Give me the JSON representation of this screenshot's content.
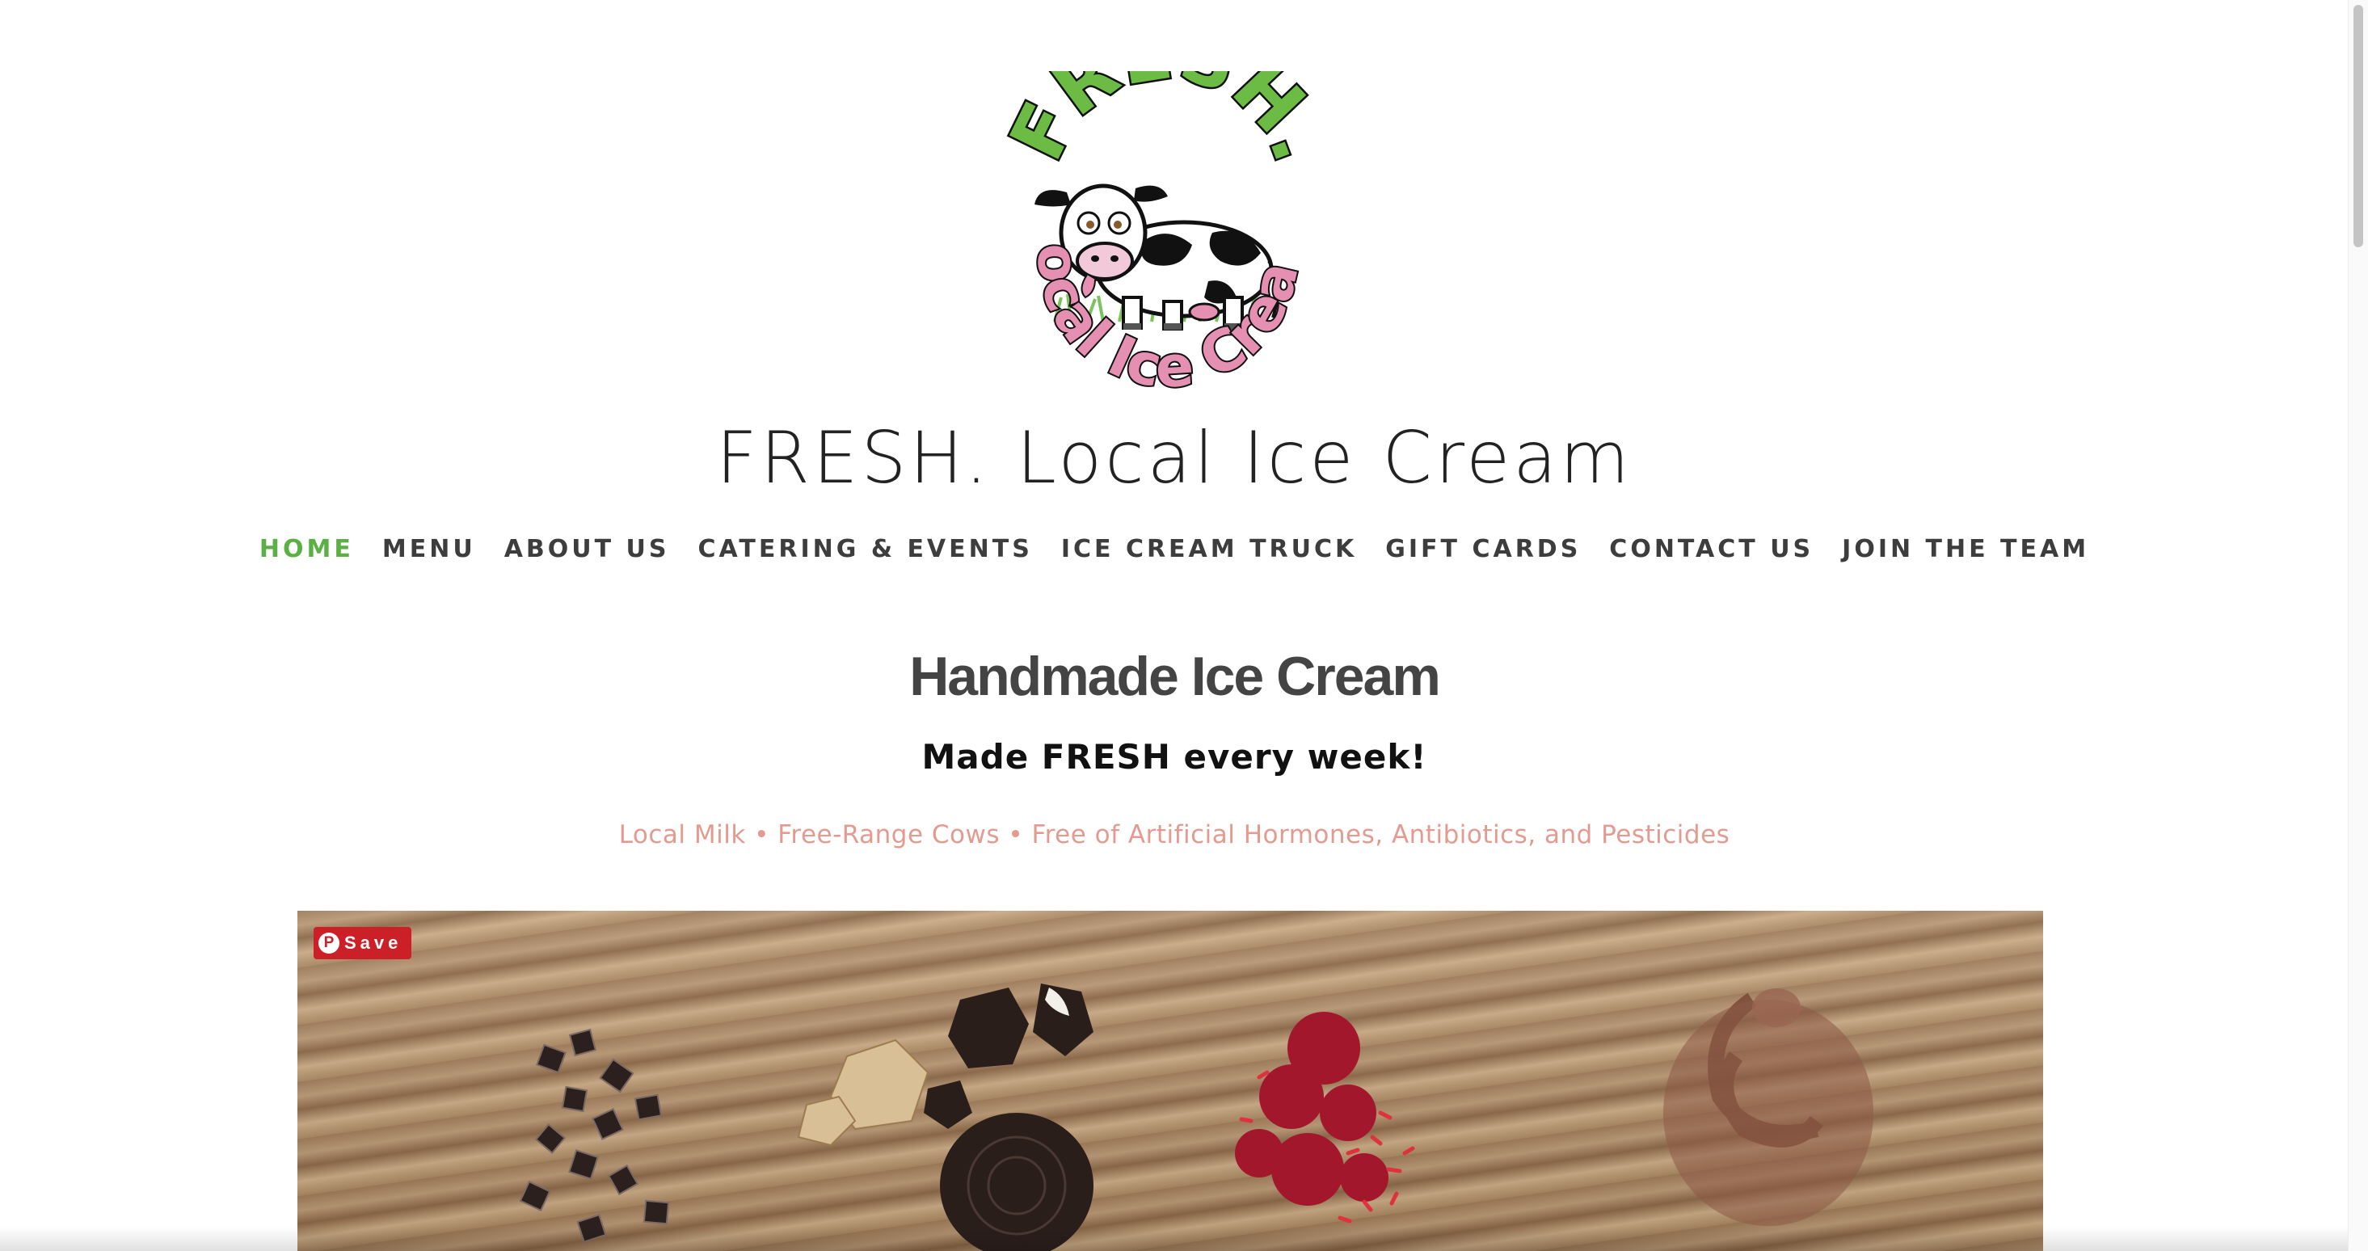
{
  "logo": {
    "alt": "FRESH. Local Ice Cream logo",
    "colors": {
      "green": "#6cbb45",
      "pink": "#e58fb3",
      "outline": "#111111"
    }
  },
  "site_title": "FRESH. Local Ice Cream",
  "nav": {
    "items": [
      {
        "label": "HOME",
        "active": true
      },
      {
        "label": "MENU",
        "active": false
      },
      {
        "label": "ABOUT US",
        "active": false
      },
      {
        "label": "CATERING & EVENTS",
        "active": false
      },
      {
        "label": "ICE CREAM TRUCK",
        "active": false
      },
      {
        "label": "GIFT CARDS",
        "active": false
      },
      {
        "label": "CONTACT US",
        "active": false
      },
      {
        "label": "JOIN THE TEAM",
        "active": false
      }
    ],
    "active_color": "#5bb043"
  },
  "hero_text": {
    "headline": "Handmade Ice Cream",
    "subhead": "Made FRESH every week!",
    "tagline": "Local Milk  • Free-Range Cows • Free of Artificial Hormones, Antibiotics, and Pesticides"
  },
  "hero_image": {
    "alt": "Ice cream mix-ins on wooden board",
    "save_button": "Save"
  }
}
